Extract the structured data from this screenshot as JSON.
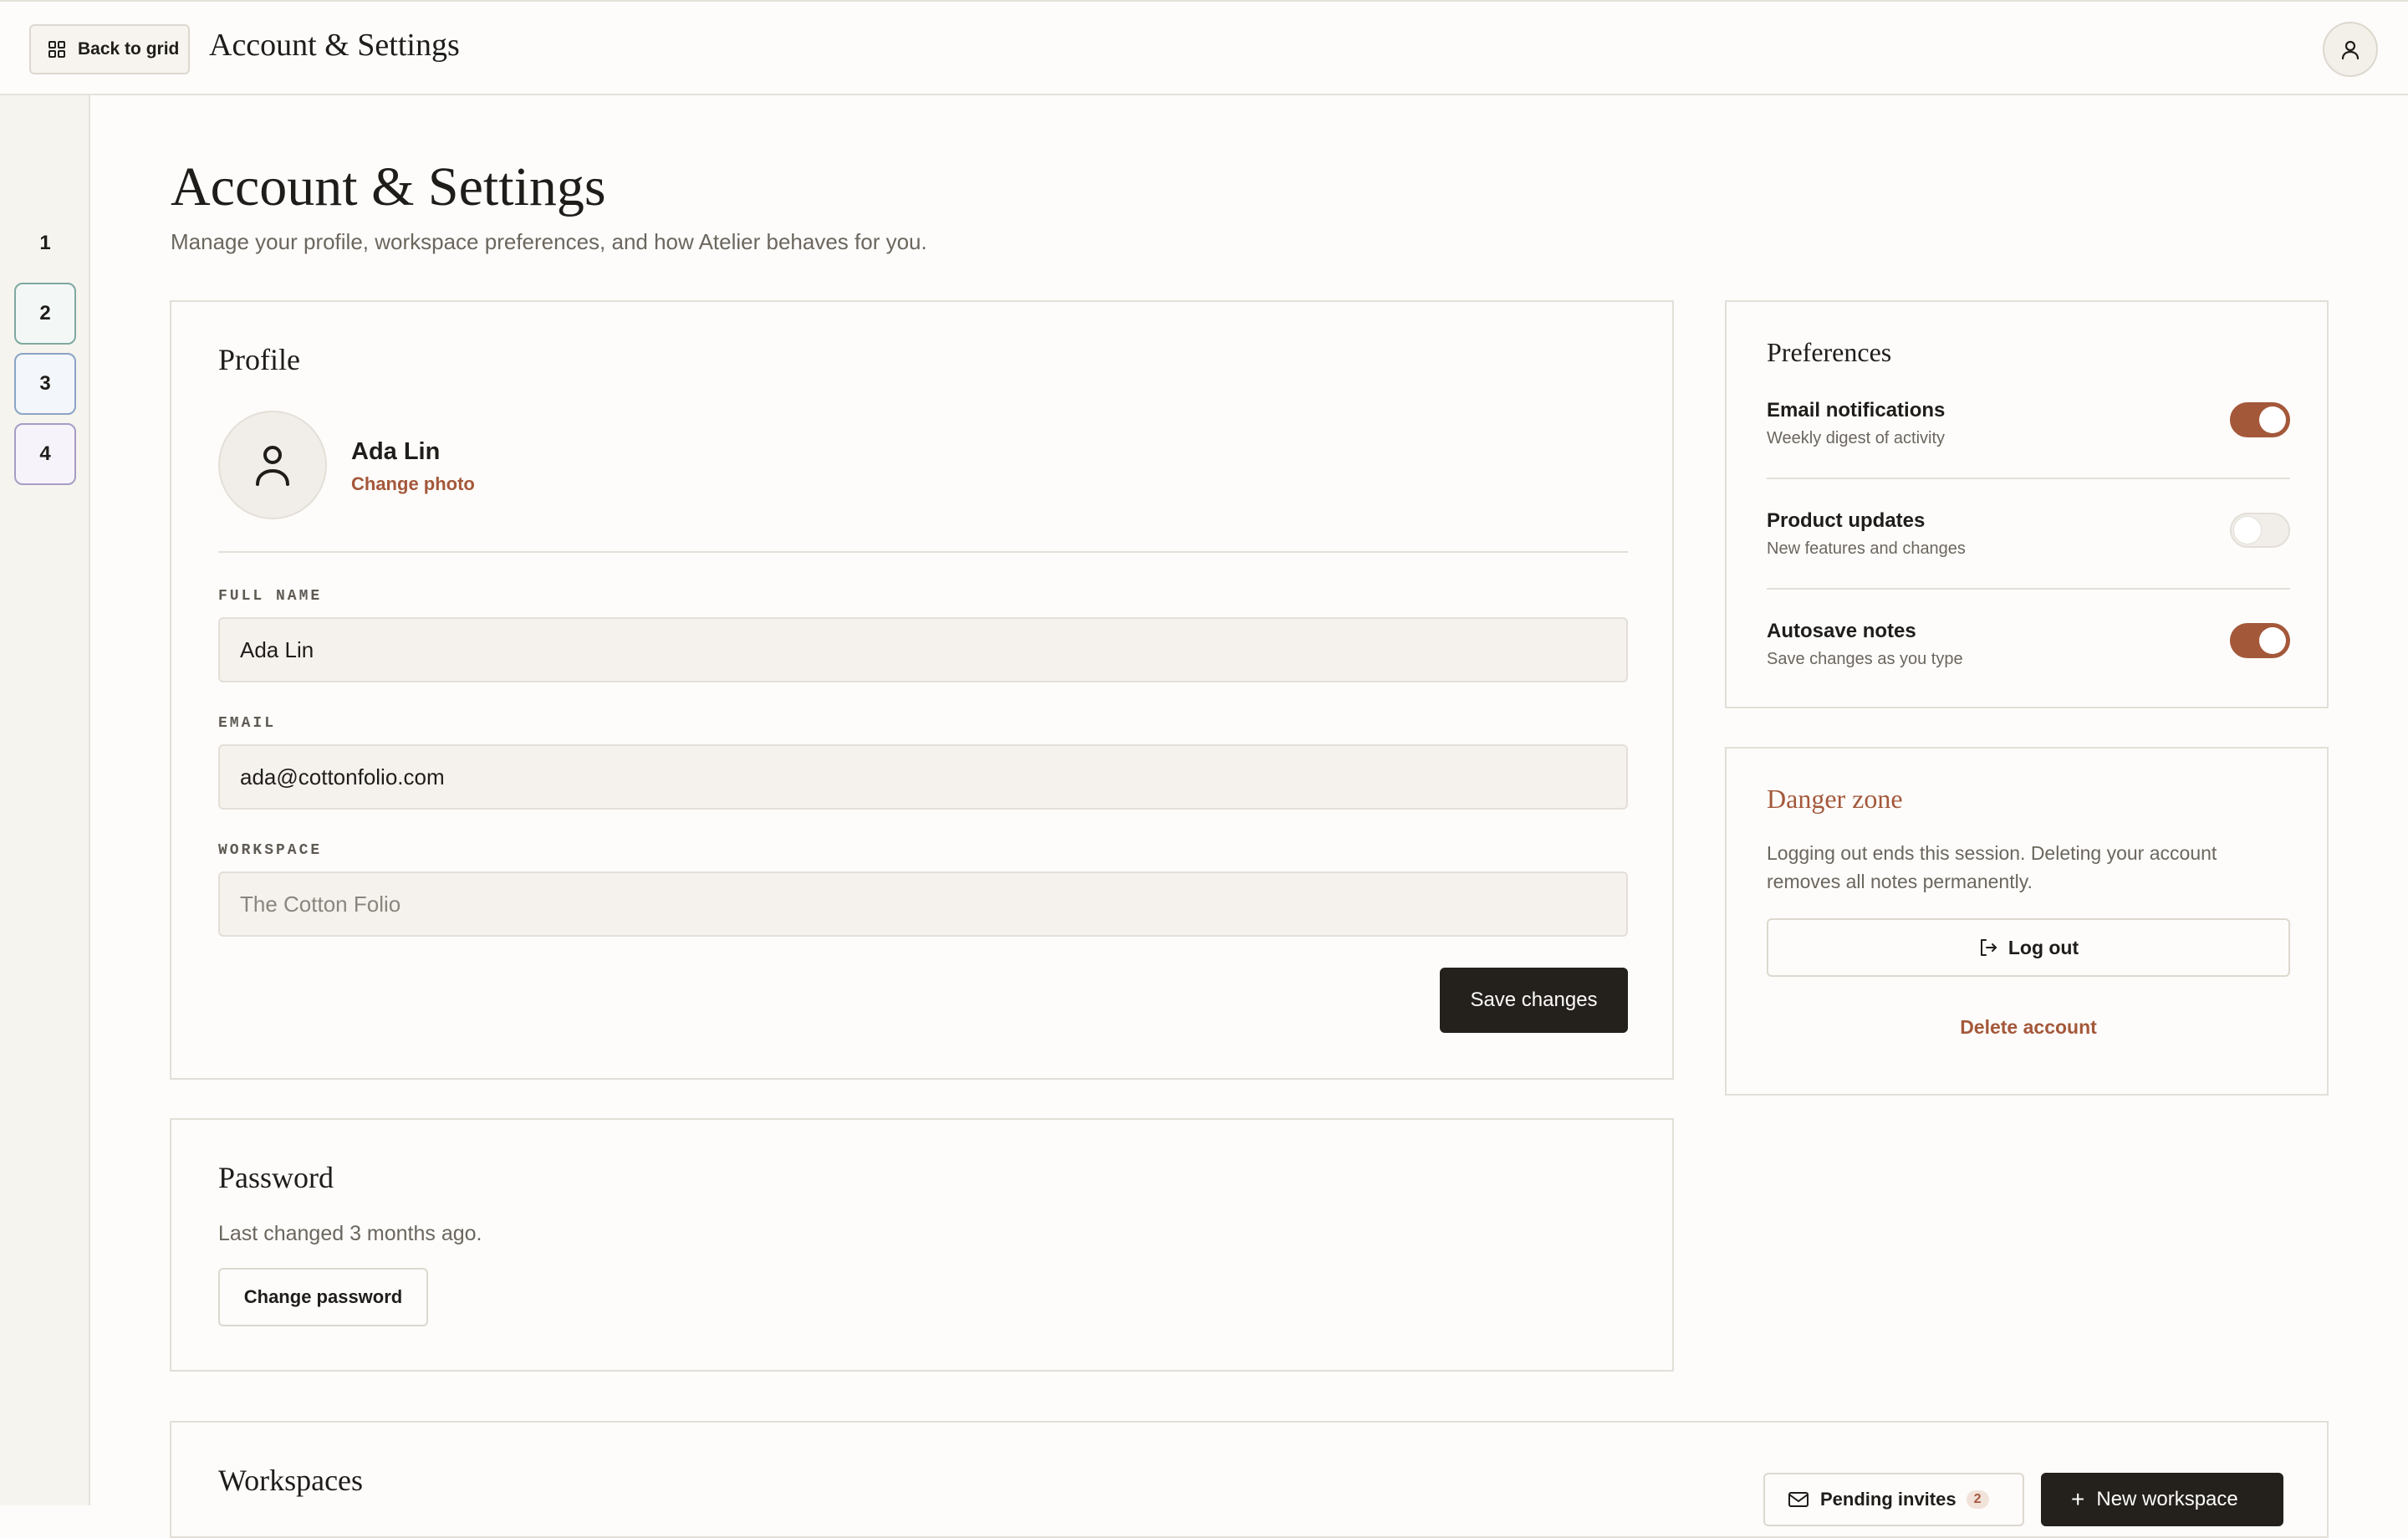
{
  "topbar": {
    "back_label": "Back to grid",
    "back_icon": "grid-icon",
    "title": "Account & Settings",
    "user_icon": "user-icon"
  },
  "rail": {
    "items": [
      "1",
      "2",
      "3",
      "4"
    ]
  },
  "header": {
    "title": "Account & Settings",
    "subtitle": "Manage your profile, workspace preferences, and how Atelier behaves for you."
  },
  "profile": {
    "title": "Profile",
    "name": "Ada Lin",
    "change_photo": "Change photo",
    "fields": [
      {
        "label": "FULL NAME",
        "value": "Ada Lin"
      },
      {
        "label": "EMAIL",
        "value": "ada@cottonfolio.com"
      },
      {
        "label": "WORKSPACE",
        "placeholder": "The Cotton Folio"
      }
    ],
    "save_label": "Save changes"
  },
  "password": {
    "title": "Password",
    "status": "Last changed 3 months ago.",
    "change_label": "Change password"
  },
  "workspaces": {
    "title": "Workspaces",
    "invites_label": "Pending invites",
    "invites_count": "2",
    "new_label": "New workspace"
  },
  "preferences": {
    "title": "Preferences",
    "items": [
      {
        "label": "Email notifications",
        "desc": "Weekly digest of activity",
        "on": true
      },
      {
        "label": "Product updates",
        "desc": "New features and changes",
        "on": false
      },
      {
        "label": "Autosave notes",
        "desc": "Save changes as you type",
        "on": true
      }
    ]
  },
  "danger": {
    "title": "Danger zone",
    "text": "Logging out ends this session. Deleting your account removes all notes permanently.",
    "logout_label": "Log out",
    "delete_label": "Delete account"
  },
  "colors": {
    "accent": "#a4583a",
    "dark": "#24211d",
    "background": "#fdfcfa"
  }
}
